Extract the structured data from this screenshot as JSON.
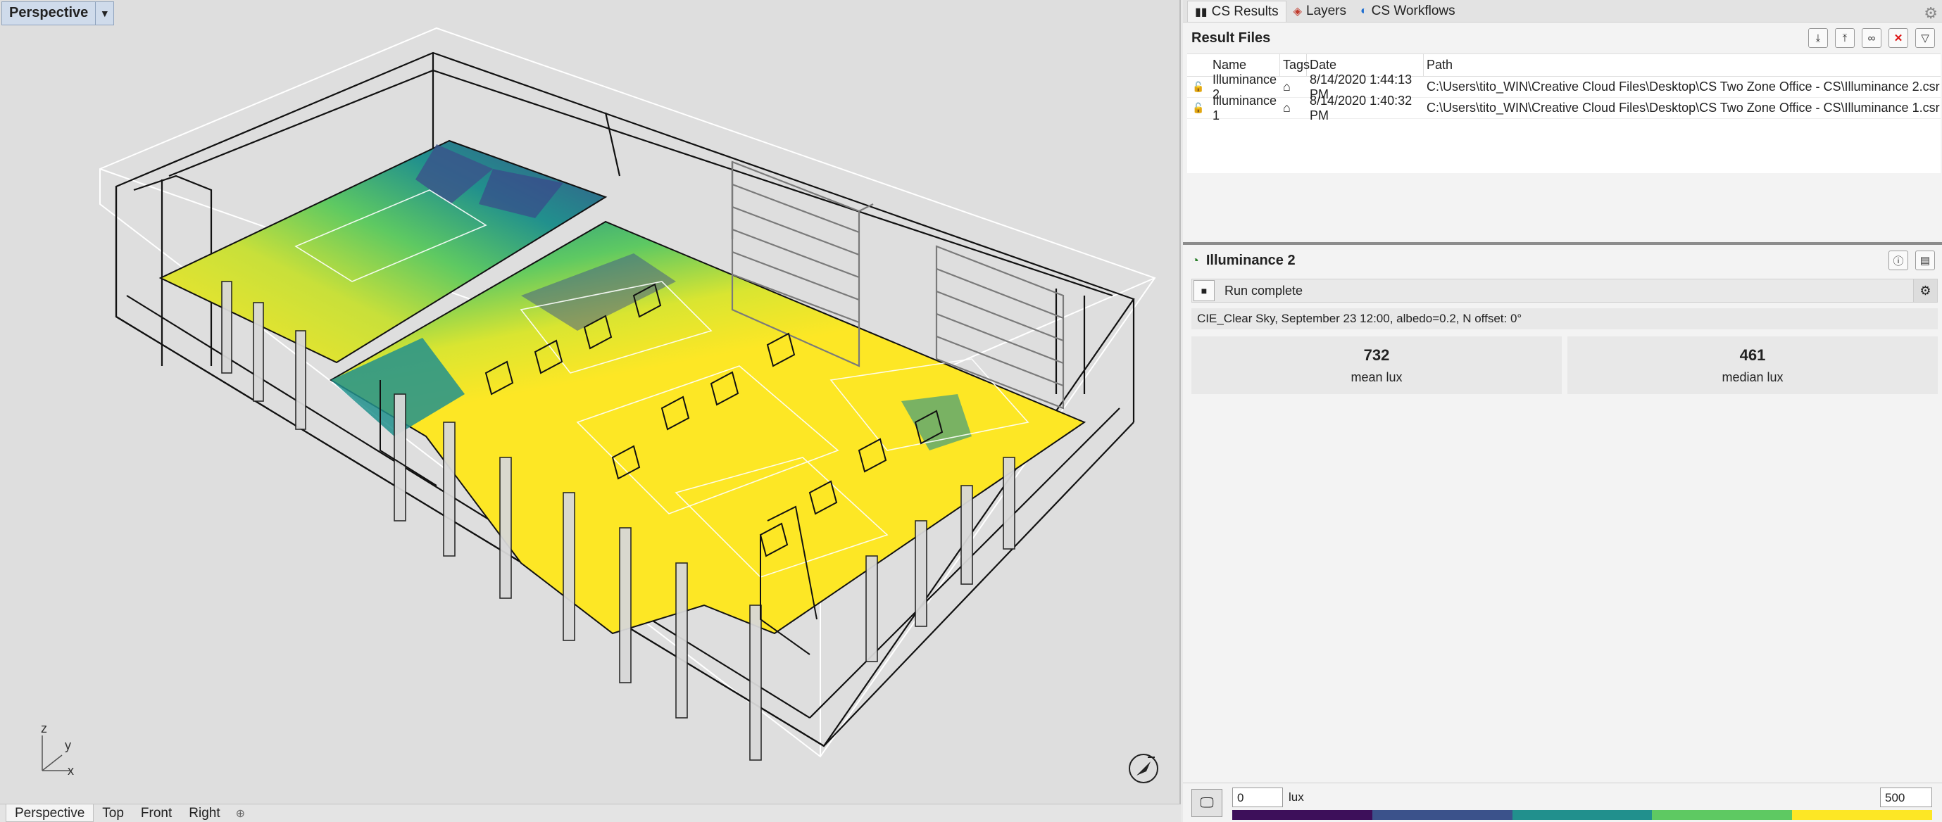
{
  "viewport": {
    "title": "Perspective",
    "axes": {
      "x": "x",
      "y": "y",
      "z": "z"
    },
    "tabs": [
      "Perspective",
      "Top",
      "Front",
      "Right"
    ]
  },
  "panel": {
    "tabs": [
      {
        "label": "CS Results",
        "icon": "chart-icon"
      },
      {
        "label": "Layers",
        "icon": "layers-icon"
      },
      {
        "label": "CS Workflows",
        "icon": "workflow-icon"
      }
    ],
    "result_files": {
      "title": "Result Files",
      "columns": {
        "name": "Name",
        "tags": "Tags",
        "date": "Date",
        "path": "Path"
      },
      "rows": [
        {
          "name": "Illuminance 2",
          "date": "8/14/2020 1:44:13 PM",
          "path": "C:\\Users\\tito_WIN\\Creative Cloud Files\\Desktop\\CS Two Zone Office - CS\\Illuminance 2.csr"
        },
        {
          "name": "Illuminance 1",
          "date": "8/14/2020 1:40:32 PM",
          "path": "C:\\Users\\tito_WIN\\Creative Cloud Files\\Desktop\\CS Two Zone Office - CS\\Illuminance 1.csr"
        }
      ]
    },
    "detail": {
      "title": "Illuminance 2",
      "status": "Run complete",
      "sky": "CIE_Clear Sky, September 23 12:00, albedo=0.2, N offset: 0°",
      "mean": {
        "value": "732",
        "label": "mean lux"
      },
      "median": {
        "value": "461",
        "label": "median lux"
      }
    },
    "legend": {
      "min": "0",
      "max": "500",
      "unit": "lux",
      "colors": [
        "#3d0f5a",
        "#3b528b",
        "#21908d",
        "#5ec962",
        "#fde725"
      ]
    }
  }
}
